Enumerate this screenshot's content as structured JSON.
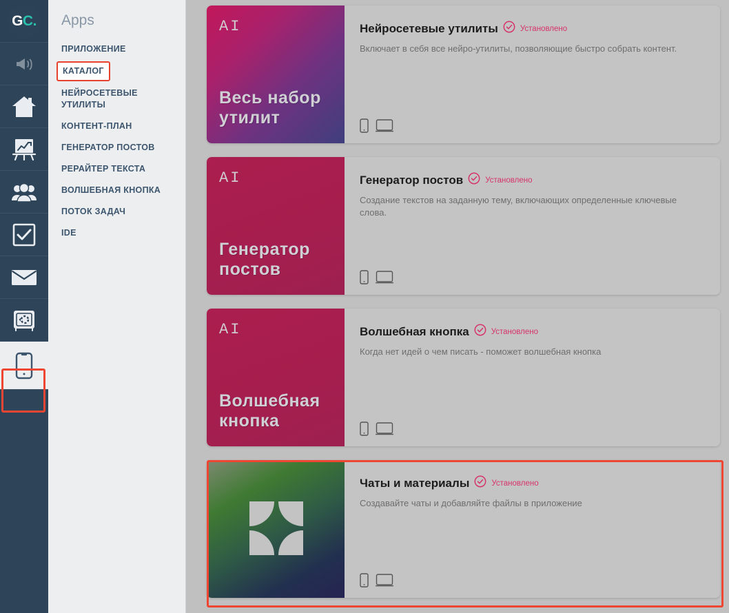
{
  "brand": {
    "logo_text_1": "GC",
    "logo_text_2": "C.",
    "logo_full": "GC."
  },
  "rail": {
    "items": [
      {
        "name": "megaphone-icon",
        "label": "Рассылки",
        "active": false
      },
      {
        "name": "home-icon",
        "label": "Главная",
        "active": false
      },
      {
        "name": "analytics-easel-icon",
        "label": "Аналитика",
        "active": false
      },
      {
        "name": "users-icon",
        "label": "Пользователи",
        "active": false
      },
      {
        "name": "checkbox-icon",
        "label": "Задачи",
        "active": false
      },
      {
        "name": "mail-icon",
        "label": "Почта",
        "active": false
      },
      {
        "name": "safe-icon",
        "label": "Сейф",
        "active": false
      },
      {
        "name": "mobile-app-icon",
        "label": "Приложение",
        "active": true
      }
    ]
  },
  "sidebar": {
    "title": "Apps",
    "items": [
      {
        "label": "ПРИЛОЖЕНИЕ",
        "highlighted": false
      },
      {
        "label": "КАТАЛОГ",
        "highlighted": true
      },
      {
        "label": "НЕЙРОСЕТЕВЫЕ УТИЛИТЫ",
        "highlighted": false
      },
      {
        "label": "КОНТЕНТ-ПЛАН",
        "highlighted": false
      },
      {
        "label": "ГЕНЕРАТОР ПОСТОВ",
        "highlighted": false
      },
      {
        "label": "РЕРАЙТЕР ТЕКСТА",
        "highlighted": false
      },
      {
        "label": "ВОЛШЕБНАЯ КНОПКА",
        "highlighted": false
      },
      {
        "label": "ПОТОК ЗАДАЧ",
        "highlighted": false
      },
      {
        "label": "IDE",
        "highlighted": false
      }
    ]
  },
  "catalog": {
    "installed_label": "Установлено",
    "cards": [
      {
        "thumb_badge": "AI",
        "thumb_caption": "Весь набор\nутилит",
        "title": "Нейросетевые утилиты",
        "status": "Установлено",
        "description": "Включает в себя все нейро-утилиты, позволяющие быстро собрать контент.",
        "platforms": [
          "mobile-icon",
          "desktop-icon"
        ],
        "selected": false
      },
      {
        "thumb_badge": "AI",
        "thumb_caption": "Генератор\nпостов",
        "title": "Генератор постов",
        "status": "Установлено",
        "description": "Создание текстов на заданную тему, включающих определенные ключевые слова.",
        "platforms": [
          "mobile-icon",
          "desktop-icon"
        ],
        "selected": false
      },
      {
        "thumb_badge": "AI",
        "thumb_caption": "Волшебная\nкнопка",
        "title": "Волшебная кнопка",
        "status": "Установлено",
        "description": "Когда нет идей о чем писать - поможет волшебная кнопка",
        "platforms": [
          "mobile-icon",
          "desktop-icon"
        ],
        "selected": false
      },
      {
        "thumb_badge": "",
        "thumb_caption": "",
        "title": "Чаты и материалы",
        "status": "Установлено",
        "description": "Создавайте чаты и добавляйте файлы в приложение",
        "platforms": [
          "mobile-icon",
          "desktop-icon"
        ],
        "selected": true
      }
    ]
  },
  "colors": {
    "rail_bg": "#2e4458",
    "panel_bg": "#eceef0",
    "content_bg": "#c0c0c0",
    "card_bg": "#c4c4c4",
    "accent_pink": "#d6336c",
    "highlight_red": "#ef4533",
    "brand_teal": "#2bbfae",
    "nav_text": "#3d566e"
  }
}
